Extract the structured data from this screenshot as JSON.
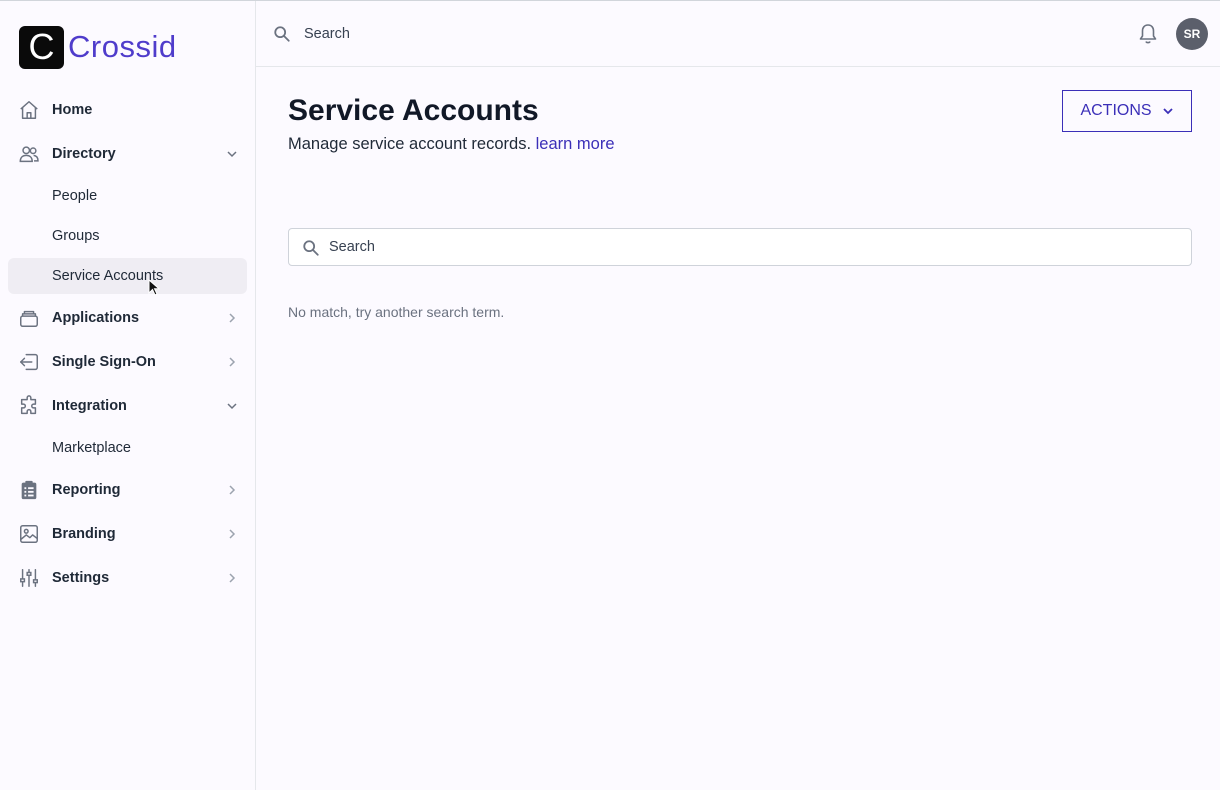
{
  "brand": {
    "logo_letter": "C",
    "name": "Crossid"
  },
  "header": {
    "search_placeholder": "Search",
    "avatar_initials": "SR"
  },
  "sidebar": {
    "home": "Home",
    "directory": "Directory",
    "people": "People",
    "groups": "Groups",
    "service_accounts": "Service Accounts",
    "applications": "Applications",
    "sso": "Single Sign-On",
    "integration": "Integration",
    "marketplace": "Marketplace",
    "reporting": "Reporting",
    "branding": "Branding",
    "settings": "Settings"
  },
  "main": {
    "title": "Service Accounts",
    "subtitle": "Manage service account records.",
    "learn_more": "learn more",
    "actions_label": "ACTIONS",
    "search_placeholder": "Search",
    "empty_message": "No match, try another search term."
  },
  "icons": {
    "home": "home-icon",
    "directory": "users-icon",
    "applications": "stack-icon",
    "sso": "login-icon",
    "integration": "puzzle-icon",
    "reporting": "clipboard-icon",
    "branding": "image-icon",
    "settings": "sliders-icon",
    "notifications": "bell-icon"
  },
  "colors": {
    "accent": "#3b2fb8",
    "logo_text": "#4f3ccb",
    "active_item_bg": "#efedf3"
  }
}
